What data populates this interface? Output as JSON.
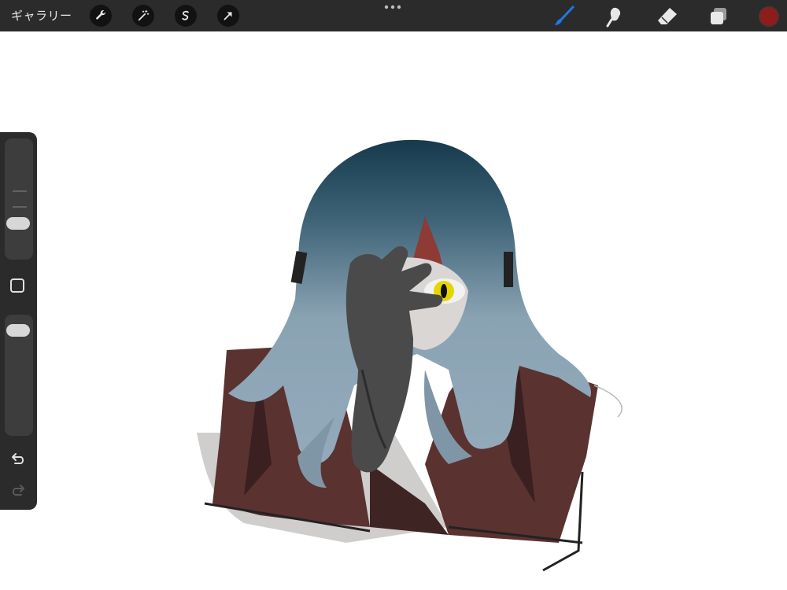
{
  "toolbar": {
    "gallery_label": "ギャラリー",
    "left_tools": [
      "wrench-icon",
      "magic-wand-icon",
      "selection-s-icon",
      "transform-arrow-icon"
    ],
    "right_tools": [
      "brush-icon",
      "smudge-icon",
      "eraser-icon",
      "layers-icon"
    ],
    "active_tool": "brush-icon",
    "active_color": "#8c1d1d",
    "accent_color": "#1e78e6"
  },
  "sidebar": {
    "brush_size_level": 0.37,
    "opacity_level": 0.92
  },
  "canvas": {
    "background": "#ffffff"
  }
}
